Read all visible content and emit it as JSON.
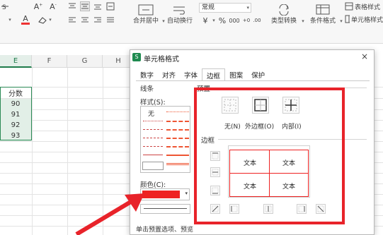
{
  "ribbon": {
    "font_color_glyph": "A",
    "number_format": "常规",
    "currency_symbol": "¥",
    "percent_symbol": "%",
    "thousands_symbol": "000",
    "decimal_inc": "+0",
    "decimal_dec": ".00",
    "merge_label": "合并居中",
    "wrap_label": "自动换行",
    "type_convert_label": "类型转换",
    "conditional_format_label": "条件格式",
    "table_style_label": "表格样式",
    "cell_style_label": "单元格样式"
  },
  "sheet": {
    "columns": [
      "E",
      "F",
      "G",
      "H"
    ],
    "selected_column": "E",
    "cells": [
      "分数",
      "90",
      "91",
      "92",
      "93"
    ]
  },
  "dialog": {
    "title": "单元格格式",
    "close": "×",
    "tabs": [
      "数字",
      "对齐",
      "字体",
      "边框",
      "图案",
      "保护"
    ],
    "active_tab": "边框",
    "line_group": "线条",
    "style_label": "样式(S):",
    "style_none": "无",
    "color_label": "颜色(C):",
    "selected_color": "#ee2222",
    "preset_group": "预置",
    "presets": [
      "无(N)",
      "外边框(O)",
      "内部(I)"
    ],
    "border_group": "边框",
    "preview_texts": [
      "文本",
      "文本",
      "文本",
      "文本"
    ],
    "note": "单击预置选项、预览"
  },
  "highlight_color": "#e8232a"
}
